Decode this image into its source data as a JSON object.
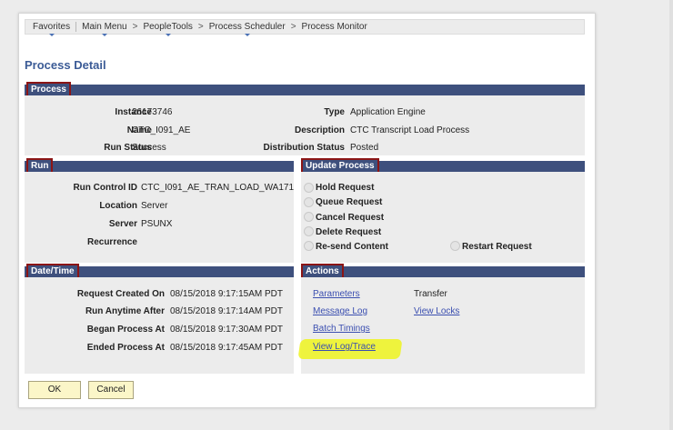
{
  "nav": {
    "items": [
      {
        "label": "Favorites"
      },
      {
        "label": "Main Menu"
      },
      {
        "label": "PeopleTools"
      },
      {
        "label": "Process Scheduler"
      },
      {
        "label": "Process Monitor"
      }
    ],
    "separator": ">"
  },
  "page_title": "Process Detail",
  "process": {
    "header": "Process",
    "instance_label": "Instance",
    "instance_value": "26173746",
    "name_label": "Name",
    "name_value": "CTC_I091_AE",
    "run_status_label": "Run Status",
    "run_status_value": "Success",
    "type_label": "Type",
    "type_value": "Application Engine",
    "description_label": "Description",
    "description_value": "CTC Transcript Load Process",
    "dist_status_label": "Distribution Status",
    "dist_status_value": "Posted"
  },
  "run": {
    "header": "Run",
    "run_control_label": "Run Control ID",
    "run_control_value": "CTC_I091_AE_TRAN_LOAD_WA171",
    "location_label": "Location",
    "location_value": "Server",
    "server_label": "Server",
    "server_value": "PSUNX",
    "recurrence_label": "Recurrence",
    "recurrence_value": ""
  },
  "update_process": {
    "header": "Update Process",
    "options": {
      "hold": "Hold Request",
      "queue": "Queue Request",
      "cancel": "Cancel Request",
      "delete": "Delete Request",
      "resend": "Re-send Content",
      "restart": "Restart Request"
    }
  },
  "datetime": {
    "header": "Date/Time",
    "requested_label": "Request Created On",
    "requested_value": "08/15/2018  9:17:15AM PDT",
    "run_anytime_label": "Run Anytime After",
    "run_anytime_value": "08/15/2018  9:17:14AM PDT",
    "began_label": "Began Process At",
    "began_value": "08/15/2018  9:17:30AM PDT",
    "ended_label": "Ended Process At",
    "ended_value": "08/15/2018  9:17:45AM PDT"
  },
  "actions": {
    "header": "Actions",
    "parameters": "Parameters",
    "transfer": "Transfer",
    "message_log": "Message Log",
    "view_locks": "View Locks",
    "batch_timings": "Batch Timings",
    "view_log_trace": "View Log/Trace"
  },
  "buttons": {
    "ok": "OK",
    "cancel": "Cancel"
  },
  "colors": {
    "section_bar": "#3e507d",
    "callout_border": "#8b1515",
    "link": "#3b4fb0",
    "title": "#3b5b96",
    "highlight": "#eef42a"
  }
}
